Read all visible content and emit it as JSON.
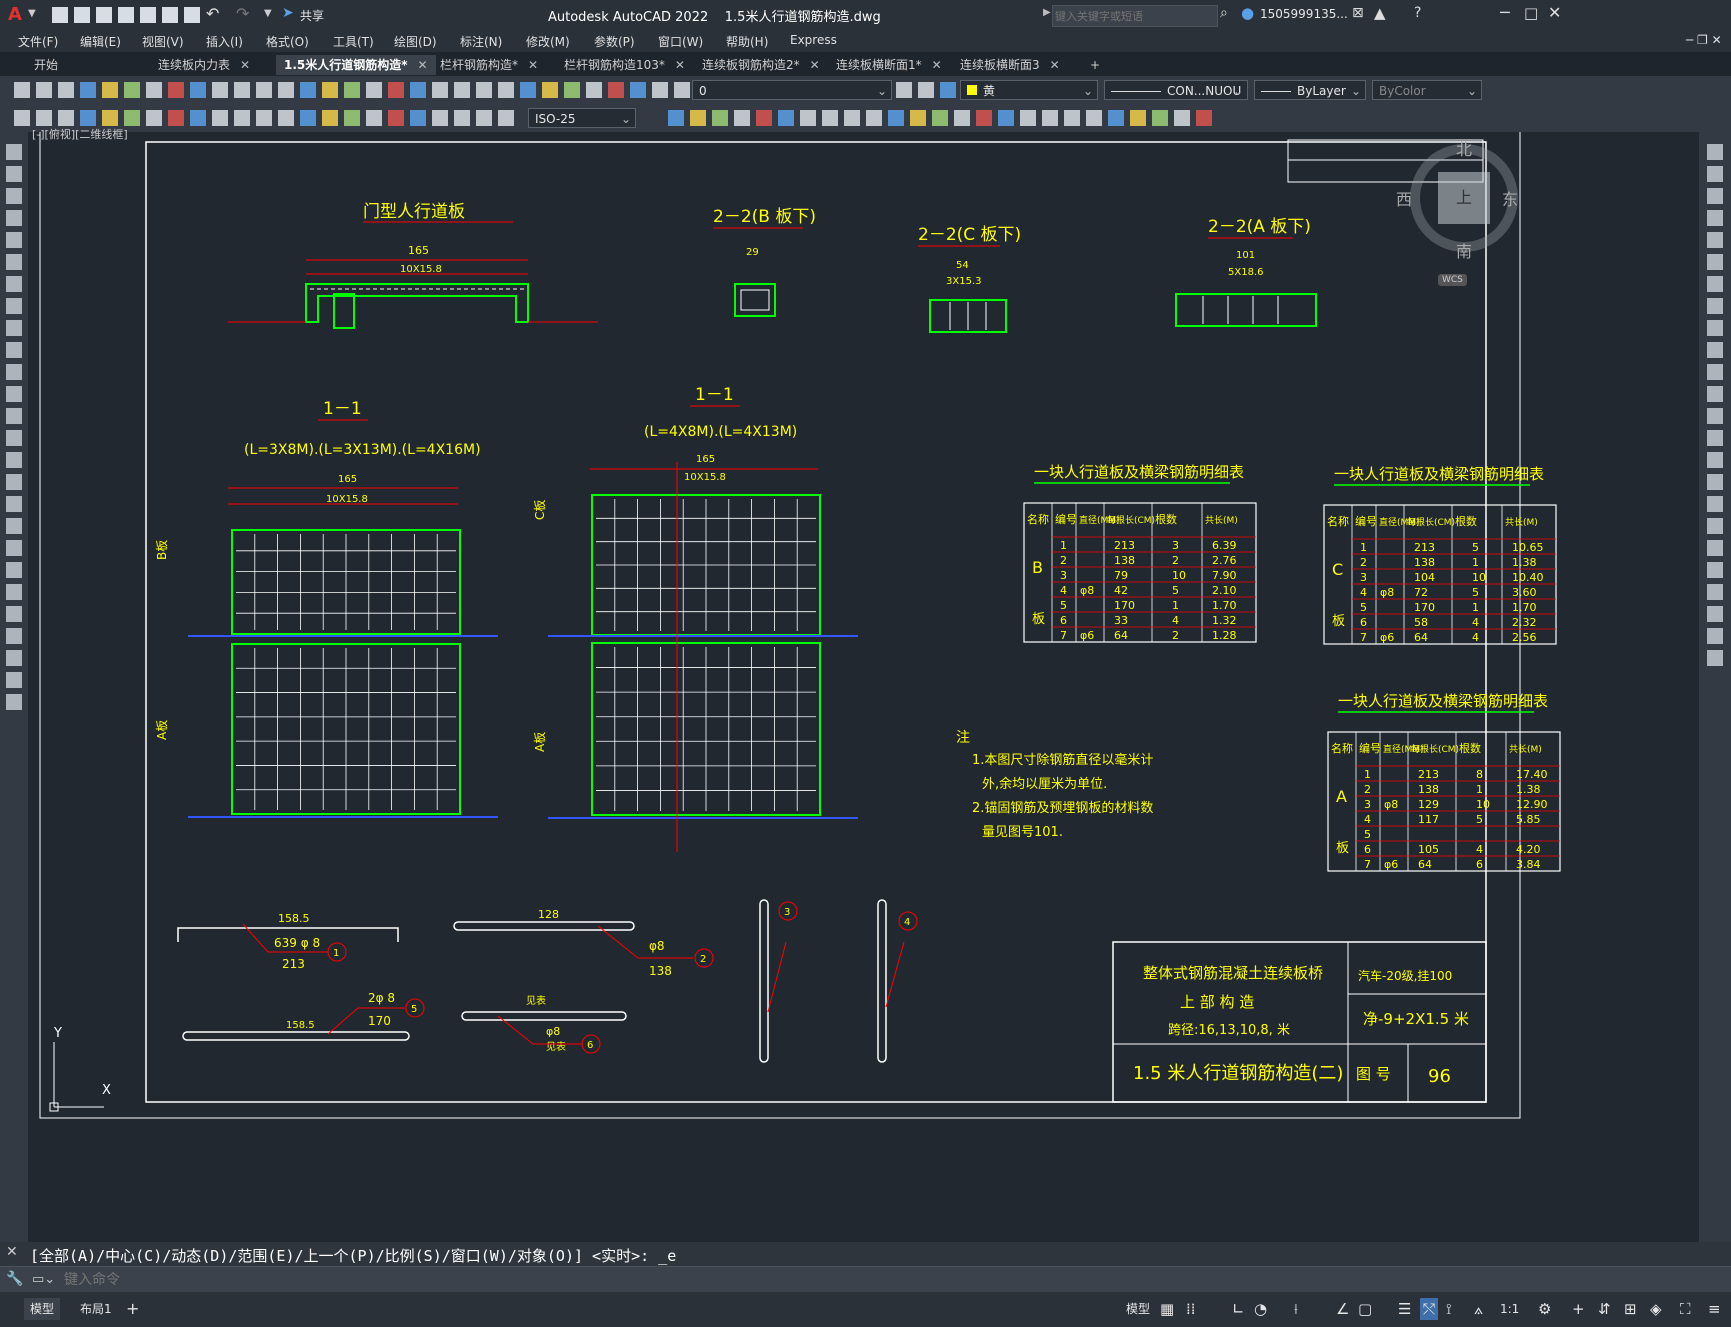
{
  "app": {
    "logo": "A",
    "title": "Autodesk AutoCAD 2022    1.5米人行道钢筋构造.dwg",
    "share_label": "共享",
    "search_placeholder": "键入关键字或短语",
    "user": "1505999135...",
    "help": "?"
  },
  "menu": [
    "文件(F)",
    "编辑(E)",
    "视图(V)",
    "插入(I)",
    "格式(O)",
    "工具(T)",
    "绘图(D)",
    "标注(N)",
    "修改(M)",
    "参数(P)",
    "窗口(W)",
    "帮助(H)",
    "Express"
  ],
  "tabs": [
    {
      "label": "开始",
      "close": false,
      "active": false
    },
    {
      "label": "连续板内力表",
      "close": true,
      "active": false
    },
    {
      "label": "1.5米人行道钢筋构造*",
      "close": true,
      "active": true
    },
    {
      "label": "栏杆钢筋构造*",
      "close": true,
      "active": false
    },
    {
      "label": "栏杆钢筋构造103*",
      "close": true,
      "active": false
    },
    {
      "label": "连续板钢筋构造2*",
      "close": true,
      "active": false
    },
    {
      "label": "连续板横断面1*",
      "close": true,
      "active": false
    },
    {
      "label": "连续板横断面3",
      "close": true,
      "active": false
    }
  ],
  "properties": {
    "layer_value": "0",
    "color_value": "黄",
    "linetype_value": "CON...NUOU",
    "lineweight_value": "ByLayer",
    "plotstyle_value": "ByColor",
    "dimstyle_value": "ISO-25"
  },
  "viewport_label": "[-][俯视][二维线框]",
  "viewcube": {
    "north": "北",
    "south": "南",
    "east": "东",
    "west": "西",
    "top": "上",
    "wcs": "WCS"
  },
  "ucs": {
    "x": "X",
    "y": "Y"
  },
  "drawing": {
    "title_main": "门型人行道板",
    "title_22b": "2－2(B 板下)",
    "title_22c": "2－2(C 板下)",
    "title_22a": "2－2(A 板下)",
    "title_11_left": "1－1",
    "sub_11_left": "(L=3X8M).(L=3X13M).(L=4X16M)",
    "title_11_right": "1－1",
    "sub_11_right": "(L=4X8M).(L=4X13M)",
    "dim_165": "165",
    "dim_10x158": "10X15.8",
    "dim_54": "54",
    "dim_3x153": "3X15.3",
    "dim_101": "101",
    "dim_5x186": "5X18.6",
    "dim_29": "29",
    "plate_b": "B板",
    "plate_a": "A板",
    "plate_c": "C板",
    "notes_title": "注",
    "notes": [
      "1.本图尺寸除钢筋直径以毫米计",
      "外,余均以厘米为单位.",
      "2.锚固钢筋及预埋钢板的材料数",
      "量见图号101."
    ],
    "rebar_labels": {
      "r1_dim": "158.5",
      "r1_sub": "639 φ 8",
      "r1_len": "213",
      "r2_dim": "128",
      "r2_sub": "φ8",
      "r2_len": "138",
      "r5_sub": "2φ 8",
      "r5_dim": "158.5",
      "r5_len": "170",
      "r6_dim": "见表",
      "r6_sub": "φ8",
      "r6_len": "见表"
    }
  },
  "table_b": {
    "title": "一块人行道板及横梁钢筋明细表",
    "headers": [
      "名称",
      "编号",
      "直径(MM)",
      "每根长(CM)",
      "根数",
      "共长(M)"
    ],
    "name": "B\n板",
    "rows": [
      [
        "1",
        "",
        "213",
        "3",
        "6.39"
      ],
      [
        "2",
        "",
        "138",
        "2",
        "2.76"
      ],
      [
        "3",
        "",
        "79",
        "10",
        "7.90"
      ],
      [
        "4",
        "φ8",
        "42",
        "5",
        "2.10"
      ],
      [
        "5",
        "",
        "170",
        "1",
        "1.70"
      ],
      [
        "6",
        "",
        "33",
        "4",
        "1.32"
      ],
      [
        "7",
        "φ6",
        "64",
        "2",
        "1.28"
      ]
    ]
  },
  "table_c": {
    "title": "一块人行道板及横梁钢筋明细表",
    "headers": [
      "名称",
      "编号",
      "直径(MM)",
      "每根长(CM)",
      "根数",
      "共长(M)"
    ],
    "name": "C\n板",
    "rows": [
      [
        "1",
        "",
        "213",
        "5",
        "10.65"
      ],
      [
        "2",
        "",
        "138",
        "1",
        "1.38"
      ],
      [
        "3",
        "",
        "104",
        "10",
        "10.40"
      ],
      [
        "4",
        "φ8",
        "72",
        "5",
        "3.60"
      ],
      [
        "5",
        "",
        "170",
        "1",
        "1.70"
      ],
      [
        "6",
        "",
        "58",
        "4",
        "2.32"
      ],
      [
        "7",
        "φ6",
        "64",
        "4",
        "2.56"
      ]
    ]
  },
  "table_a": {
    "title": "一块人行道板及横梁钢筋明细表",
    "headers": [
      "名称",
      "编号",
      "直径(MM)",
      "每根长(CM)",
      "根数",
      "共长(M)"
    ],
    "name": "A\n板",
    "rows": [
      [
        "1",
        "",
        "213",
        "8",
        "17.40"
      ],
      [
        "2",
        "",
        "138",
        "1",
        "1.38"
      ],
      [
        "3",
        "φ8",
        "129",
        "10",
        "12.90"
      ],
      [
        "4",
        "",
        "117",
        "5",
        "5.85"
      ],
      [
        "5",
        "",
        "",
        "",
        ""
      ],
      [
        "6",
        "",
        "105",
        "4",
        "4.20"
      ],
      [
        "7",
        "φ6",
        "64",
        "6",
        "3.84"
      ]
    ]
  },
  "titleblock": {
    "project": "整体式钢筋混凝土连续板桥",
    "part": "上 部 构 造",
    "span": "跨径:16,13,10,8,    米",
    "load": "汽车-20级,挂100",
    "width": "净-9+2X1.5 米",
    "drawing_name": "1.5 米人行道钢筋构造(二)",
    "fig_label": "图 号",
    "fig_no": "96"
  },
  "command": {
    "history": "[全部(A)/中心(C)/动态(D)/范围(E)/上一个(P)/比例(S)/窗口(W)/对象(O)] <实时>: _e",
    "placeholder": "键入命令"
  },
  "status": {
    "model_tab": "模型",
    "layout_tab": "布局1",
    "model_label": "模型",
    "scale": "1:1"
  }
}
